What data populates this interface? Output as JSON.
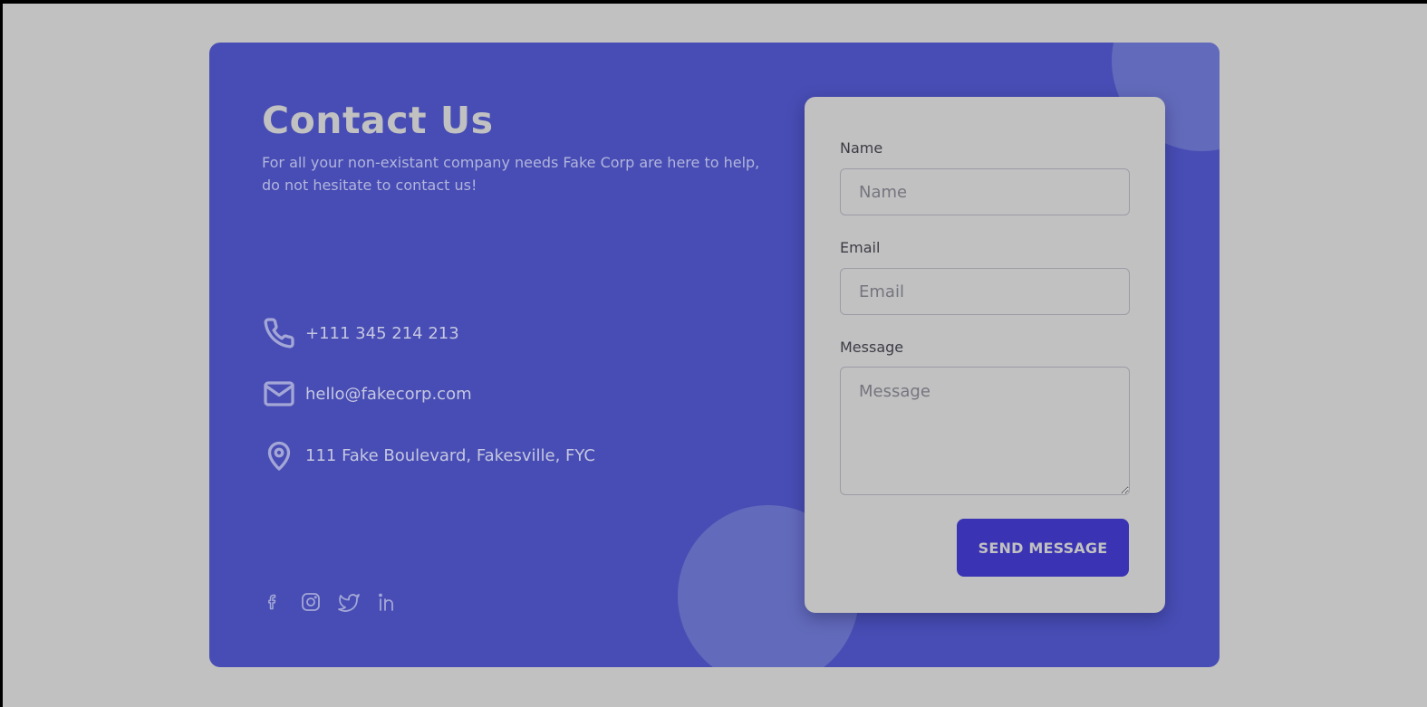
{
  "contact": {
    "title": "Contact Us",
    "subtitle": "For all your non-existant company needs Fake Corp are here to help, do not hesitate to contact us!",
    "phone": "+111 345 214 213",
    "email": "hello@fakecorp.com",
    "address": "111 Fake Boulevard, Fakesville, FYC"
  },
  "socials": [
    {
      "icon": "facebook-icon"
    },
    {
      "icon": "instagram-icon"
    },
    {
      "icon": "twitter-icon"
    },
    {
      "icon": "linkedin-icon"
    }
  ],
  "form": {
    "name_label": "Name",
    "name_placeholder": "Name",
    "email_label": "Email",
    "email_placeholder": "Email",
    "message_label": "Message",
    "message_placeholder": "Message",
    "submit_label": "SEND MESSAGE"
  },
  "colors": {
    "page_background": "#c1c1c1",
    "card_background": "#474db4",
    "accent_circle": "#626abb",
    "button_background": "#3a33b4"
  }
}
